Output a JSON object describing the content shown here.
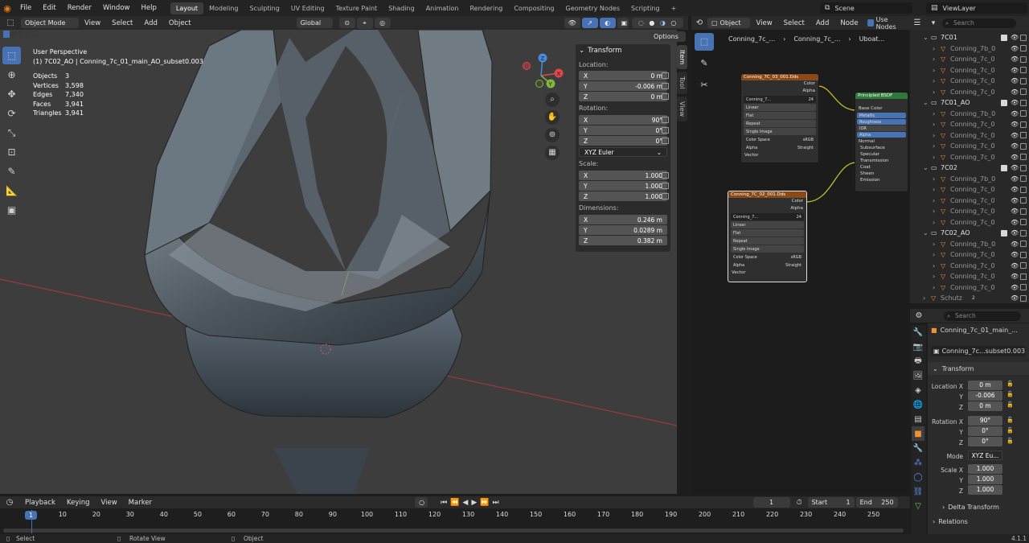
{
  "menubar": {
    "items": [
      "File",
      "Edit",
      "Render",
      "Window",
      "Help"
    ],
    "workspaces": [
      "Layout",
      "Modeling",
      "Sculpting",
      "UV Editing",
      "Texture Paint",
      "Shading",
      "Animation",
      "Rendering",
      "Compositing",
      "Geometry Nodes",
      "Scripting"
    ],
    "active_workspace": "Layout",
    "add_workspace": "+",
    "scene": "Scene",
    "view_layer": "ViewLayer"
  },
  "viewport_header": {
    "mode": "Object Mode",
    "menus": [
      "View",
      "Select",
      "Add",
      "Object"
    ],
    "transform_orientation": "Global",
    "options": "Options"
  },
  "viewport": {
    "perspective": "User Perspective",
    "object_name": "(1) 7C02_AO | Conning_7c_01_main_AO_subset0.003",
    "stats": [
      {
        "label": "Objects",
        "value": "3"
      },
      {
        "label": "Vertices",
        "value": "3,598"
      },
      {
        "label": "Edges",
        "value": "7,340"
      },
      {
        "label": "Faces",
        "value": "3,941"
      },
      {
        "label": "Triangles",
        "value": "3,941"
      }
    ],
    "gizmo": {
      "x": "X",
      "y": "Y",
      "z": "Z"
    }
  },
  "npanel": {
    "title": "Transform",
    "location_label": "Location:",
    "location": [
      {
        "axis": "X",
        "value": "0 m"
      },
      {
        "axis": "Y",
        "value": "-0.006 m"
      },
      {
        "axis": "Z",
        "value": "0 m"
      }
    ],
    "rotation_label": "Rotation:",
    "rotation": [
      {
        "axis": "X",
        "value": "90°"
      },
      {
        "axis": "Y",
        "value": "0°"
      },
      {
        "axis": "Z",
        "value": "0°"
      }
    ],
    "rotation_mode": "XYZ Euler",
    "scale_label": "Scale:",
    "scale": [
      {
        "axis": "X",
        "value": "1.000"
      },
      {
        "axis": "Y",
        "value": "1.000"
      },
      {
        "axis": "Z",
        "value": "1.000"
      }
    ],
    "dimensions_label": "Dimensions:",
    "dimensions": [
      {
        "axis": "X",
        "value": "0.246 m"
      },
      {
        "axis": "Y",
        "value": "0.0289 m"
      },
      {
        "axis": "Z",
        "value": "0.382 m"
      }
    ],
    "tabs": [
      "Item",
      "Tool",
      "View"
    ]
  },
  "node_editor": {
    "object_label": "Object",
    "menus": [
      "View",
      "Select",
      "Add",
      "Node"
    ],
    "use_nodes": "Use Nodes",
    "breadcrumb": [
      "Conning_7c_...",
      "Conning_7c_...",
      "Uboat..."
    ],
    "node1": {
      "title": "Conning_7C_03_001.Dds",
      "outputs": [
        "Color",
        "Alpha"
      ],
      "image": "Conning_7...",
      "users": "24",
      "rows": [
        "Linear",
        "Flat",
        "Repeat",
        "Single Image"
      ],
      "color_space_label": "Color Space",
      "color_space": "sRGB",
      "alpha_label": "Alpha",
      "alpha": "Straight",
      "vector": "Vector"
    },
    "node2": {
      "title": "Conning_7C_02_001.Dds",
      "outputs": [
        "Color",
        "Alpha"
      ],
      "image": "Conning_7...",
      "users": "24",
      "rows": [
        "Linear",
        "Flat",
        "Repeat",
        "Single Image"
      ],
      "color_space_label": "Color Space",
      "color_space": "sRGB",
      "alpha_label": "Alpha",
      "alpha": "Straight",
      "vector": "Vector"
    },
    "bsdf": {
      "title": "Principled BSDF",
      "base_color": "Base Color",
      "fields": [
        "Metallic",
        "Roughness",
        "IOR",
        "Alpha"
      ],
      "normal": "Normal",
      "panels": [
        "Subsurface",
        "Specular",
        "Transmission",
        "Coat",
        "Sheen",
        "Emission"
      ]
    }
  },
  "outliner": {
    "search_placeholder": "Search",
    "rows": [
      {
        "label": "7C01",
        "type": "collection",
        "level": 0
      },
      {
        "label": "Conning_7b_0",
        "type": "object",
        "level": 1
      },
      {
        "label": "Conning_7c_0",
        "type": "object",
        "level": 1
      },
      {
        "label": "Conning_7c_0",
        "type": "object",
        "level": 1
      },
      {
        "label": "Conning_7c_0",
        "type": "object",
        "level": 1
      },
      {
        "label": "Conning_7c_0",
        "type": "object",
        "level": 1
      },
      {
        "label": "7C01_AO",
        "type": "collection",
        "level": 0
      },
      {
        "label": "Conning_7b_0",
        "type": "object",
        "level": 1
      },
      {
        "label": "Conning_7c_0",
        "type": "object",
        "level": 1
      },
      {
        "label": "Conning_7c_0",
        "type": "object",
        "level": 1
      },
      {
        "label": "Conning_7c_0",
        "type": "object",
        "level": 1
      },
      {
        "label": "Conning_7c_0",
        "type": "object",
        "level": 1
      },
      {
        "label": "7C02",
        "type": "collection",
        "level": 0
      },
      {
        "label": "Conning_7b_0",
        "type": "object",
        "level": 1
      },
      {
        "label": "Conning_7c_0",
        "type": "object",
        "level": 1
      },
      {
        "label": "Conning_7c_0",
        "type": "object",
        "level": 1
      },
      {
        "label": "Conning_7c_0",
        "type": "object",
        "level": 1
      },
      {
        "label": "Conning_7c_0",
        "type": "object",
        "level": 1
      },
      {
        "label": "7C02_AO",
        "type": "collection",
        "level": 0
      },
      {
        "label": "Conning_7b_0",
        "type": "object",
        "level": 1
      },
      {
        "label": "Conning_7c_0",
        "type": "object",
        "level": 1
      },
      {
        "label": "Conning_7c_0",
        "type": "object",
        "level": 1
      },
      {
        "label": "Conning_7c_0",
        "type": "object",
        "level": 1
      },
      {
        "label": "Conning_7c_0",
        "type": "object",
        "level": 1
      },
      {
        "label": "Schutz",
        "type": "object",
        "level": 0,
        "badge": "2"
      }
    ]
  },
  "properties": {
    "search_placeholder": "Search",
    "object_name": "Conning_7c_01_main_...",
    "data_name": "Conning_7c...subset0.003",
    "section": "Transform",
    "location_label": "Location X",
    "location": [
      "0 m",
      "-0.006",
      "0 m"
    ],
    "rotation_label": "Rotation X",
    "rotation": [
      "90°",
      "0°",
      "0°"
    ],
    "mode_label": "Mode",
    "mode": "XYZ Eu...",
    "scale_label": "Scale X",
    "scale": [
      "1.000",
      "1.000",
      "1.000"
    ],
    "axis_y": "Y",
    "axis_z": "Z",
    "delta_transform": "Delta Transform",
    "relations": "Relations"
  },
  "timeline": {
    "menus": [
      "Playback",
      "Keying",
      "View",
      "Marker"
    ],
    "current_frame": "1",
    "start_label": "Start",
    "start": "1",
    "end_label": "End",
    "end": "250",
    "ticks": [
      "1",
      "10",
      "20",
      "30",
      "40",
      "50",
      "60",
      "70",
      "80",
      "90",
      "100",
      "110",
      "120",
      "130",
      "140",
      "150",
      "160",
      "170",
      "180",
      "190",
      "200",
      "210",
      "220",
      "230",
      "240",
      "250"
    ]
  },
  "statusbar": {
    "select": "Select",
    "rotate": "Rotate View",
    "object": "Object",
    "version": "4.1.1"
  }
}
